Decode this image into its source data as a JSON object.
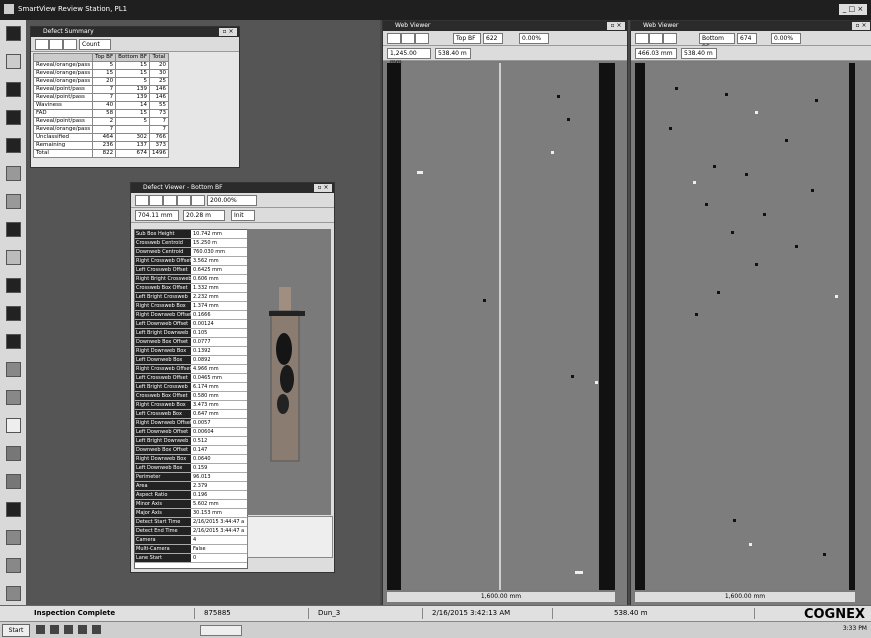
{
  "app": {
    "title": "SmartView Review Station, PL1"
  },
  "summary": {
    "title": "Defect Summary",
    "filter": "Count",
    "headers": [
      "",
      "Top BF",
      "Bottom BF",
      "Total"
    ],
    "rows": [
      [
        "Reveal/orange/pass",
        "5",
        "15",
        "20"
      ],
      [
        "Reveal/orange/pass",
        "15",
        "15",
        "30"
      ],
      [
        "Reveal/orange/pass",
        "20",
        "5",
        "25"
      ],
      [
        "Reveal/point/pass",
        "7",
        "139",
        "146"
      ],
      [
        "Reveal/point/pass",
        "7",
        "139",
        "146"
      ],
      [
        "Waviness",
        "40",
        "14",
        "55"
      ],
      [
        "FAD",
        "58",
        "15",
        "73"
      ],
      [
        "Reveal/point/pass",
        "2",
        "5",
        "7"
      ],
      [
        "Reveal/orange/pass",
        "7",
        "",
        "7"
      ],
      [
        "Unclassified",
        "464",
        "302",
        "766"
      ],
      [
        "Remaining",
        "236",
        "137",
        "373"
      ],
      [
        "Total",
        "822",
        "674",
        "1496"
      ]
    ]
  },
  "defect_viewer": {
    "title": "Defect Viewer - Bottom BF",
    "zoom": "200.00%",
    "pos_x": "704.11 mm",
    "pos_y": "20.28 m",
    "tool_label": "Init",
    "properties": [
      [
        "Sub Box Height",
        "10.742 mm"
      ],
      [
        "Crossweb Centroid",
        "15.250 m"
      ],
      [
        "Downweb Centroid",
        "760.030 mm"
      ],
      [
        "Right Crossweb Offset",
        "3.562 mm"
      ],
      [
        "Left Crossweb Offset",
        "0.6425 mm"
      ],
      [
        "Right Bright Crossweb",
        "0.606 mm"
      ],
      [
        "Crossweb Box Offset",
        "1.332 mm"
      ],
      [
        "Left Bright Crossweb",
        "2.232 mm"
      ],
      [
        "Right Crossweb Box",
        "1.374 mm"
      ],
      [
        "Right Downweb Offset",
        "0.1666"
      ],
      [
        "Left Downweb Offset",
        "0.00124"
      ],
      [
        "Left Bright Downweb",
        "0.105"
      ],
      [
        "Downweb Box Offset",
        "0.0777"
      ],
      [
        "Right Downweb Box",
        "0.1392"
      ],
      [
        "Left Downweb Box",
        "0.0892"
      ],
      [
        "Right Crossweb Offset",
        "4.966 mm"
      ],
      [
        "Left Crossweb Offset",
        "0.0465 mm"
      ],
      [
        "Left Bright Crossweb",
        "6.174 mm"
      ],
      [
        "Crossweb Box Offset",
        "0.580 mm"
      ],
      [
        "Right Crossweb Box",
        "3.473 mm"
      ],
      [
        "Left Crossweb Box",
        "0.647 mm"
      ],
      [
        "Right Downweb Offset",
        "0.0057"
      ],
      [
        "Left Downweb Offset",
        "0.00604"
      ],
      [
        "Left Bright Downweb",
        "0.512"
      ],
      [
        "Downweb Box Offset",
        "0.147"
      ],
      [
        "Right Downweb Box",
        "0.0640"
      ],
      [
        "Left Downweb Box",
        "0.159"
      ],
      [
        "Perimeter",
        "96.013"
      ],
      [
        "Area",
        "2.379"
      ],
      [
        "Aspect Ratio",
        "0.196"
      ],
      [
        "Minor Axis",
        "5.602 mm"
      ],
      [
        "Major Axis",
        "30.153 mm"
      ],
      [
        "Detect Start Time",
        "2/16/2015 3:44:47 a"
      ],
      [
        "Detect End Time",
        "2/16/2015 3:44:47 a"
      ],
      [
        "Camera",
        "4"
      ],
      [
        "Multi-Camera",
        "False"
      ],
      [
        "Lane Start",
        "0"
      ]
    ]
  },
  "web_top": {
    "title": "Web Viewer",
    "lane": "Top BF",
    "zoom": "0.00%",
    "pos_x": "1,245.00 mm",
    "pos_y": "538.40 m",
    "scale": "1,600.00 mm",
    "count": "622"
  },
  "web_bottom": {
    "title": "Web Viewer",
    "lane": "Bottom BF",
    "zoom": "0.00%",
    "pos_x": "466.03 mm",
    "pos_y": "538.40 m",
    "scale": "1,600.00 mm",
    "count": "674"
  },
  "status": {
    "state": "Inspection Complete",
    "roll": "875885",
    "lane": "Dun_3",
    "timestamp": "2/16/2015 3:42:13 AM",
    "length": "538.40 m",
    "brand": "COGNEX"
  },
  "taskbar": {
    "start": "Start",
    "clock": "3:33 PM"
  }
}
